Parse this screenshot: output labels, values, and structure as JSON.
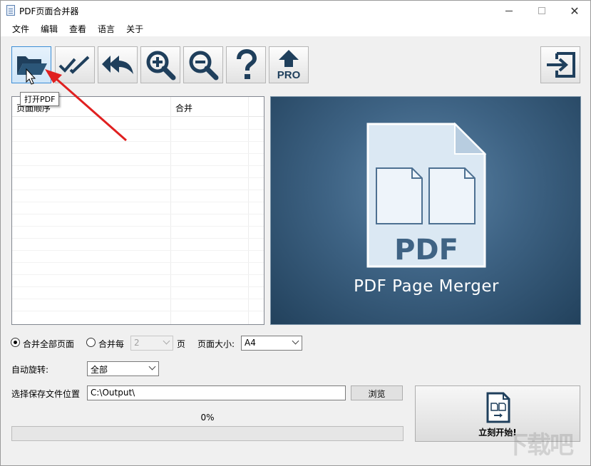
{
  "window": {
    "title": "PDF页面合并器"
  },
  "menu": [
    "文件",
    "编辑",
    "查看",
    "语言",
    "关于"
  ],
  "toolbar": {
    "buttons": [
      {
        "icon": "open-folder-icon"
      },
      {
        "icon": "double-check-icon"
      },
      {
        "icon": "reply-all-icon"
      },
      {
        "icon": "zoom-in-icon"
      },
      {
        "icon": "zoom-out-icon"
      },
      {
        "icon": "help-icon"
      },
      {
        "icon": "upgrade-pro-icon",
        "label": "PRO"
      },
      {
        "icon": "exit-icon"
      }
    ],
    "tooltip": "打开PDF"
  },
  "list": {
    "columns": [
      "页面顺序",
      "合并"
    ]
  },
  "preview": {
    "doc_label": "PDF",
    "caption": "PDF Page Merger"
  },
  "options": {
    "merge_all_label": "合并全部页面",
    "merge_every_label": "合并每",
    "merge_every_value": "2",
    "page_unit": "页",
    "page_size_label": "页面大小:",
    "page_size_value": "A4",
    "auto_rotate_label": "自动旋转:",
    "auto_rotate_value": "全部",
    "save_location_label": "选择保存文件位置",
    "save_location_value": "C:\\Output\\",
    "browse_label": "浏览"
  },
  "progress": {
    "text": "0%",
    "value": 0
  },
  "start": {
    "label": "立刻开始!"
  },
  "watermark": "下载吧",
  "colors": {
    "preview_bg": "#3e6384",
    "progress_fill": "#06b025",
    "annotation_arrow": "#e02020"
  }
}
